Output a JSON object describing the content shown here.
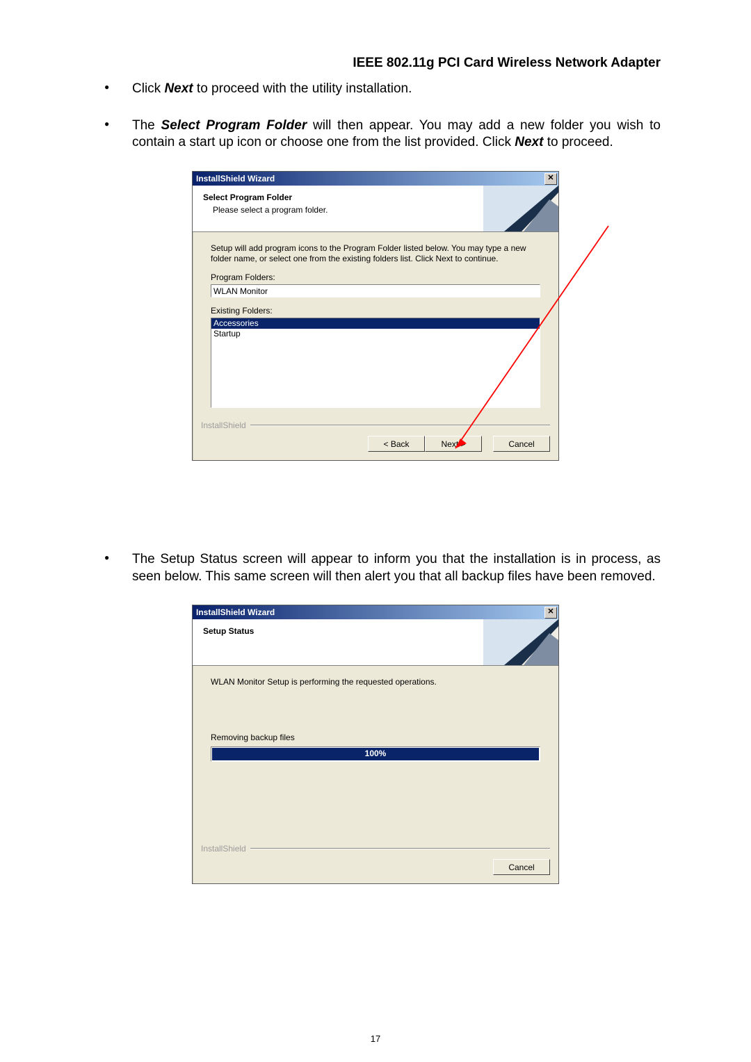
{
  "header": "IEEE 802.11g PCI Card Wireless Network Adapter",
  "bullets": {
    "b1_pre": "Click ",
    "b1_bi": "Next",
    "b1_post": " to proceed with the utility installation.",
    "b2_pre": "The ",
    "b2_bi": "Select Program Folder",
    "b2_post1": " will then appear. You may add a new folder you wish to contain a start up icon or choose one from the list provided.  Click ",
    "b2_bi2": "Next",
    "b2_post2": " to proceed.",
    "b3": "The Setup Status screen will appear to inform you that the installation is in process, as seen below. This same screen will then alert you that all backup files have been removed."
  },
  "dialog1": {
    "title": "InstallShield Wizard",
    "close": "✕",
    "banner_title": "Select Program Folder",
    "banner_sub": "Please select a program folder.",
    "instr": "Setup will add program icons to the Program Folder listed below.  You may type a new folder name, or select one from the existing folders list.  Click Next to continue.",
    "label_pf": "Program Folders:",
    "pf_value": "WLAN Monitor",
    "label_ef": "Existing Folders:",
    "ef_items": [
      "Accessories",
      "Startup"
    ],
    "brand": "InstallShield",
    "back": "< Back",
    "next": "Next >",
    "cancel": "Cancel"
  },
  "dialog2": {
    "title": "InstallShield Wizard",
    "close": "✕",
    "banner_title": "Setup Status",
    "status_line": "WLAN Monitor Setup is performing the requested operations.",
    "task": "Removing backup files",
    "progress_text": "100%",
    "progress_pct": 100,
    "brand": "InstallShield",
    "cancel": "Cancel"
  },
  "page_number": "17"
}
